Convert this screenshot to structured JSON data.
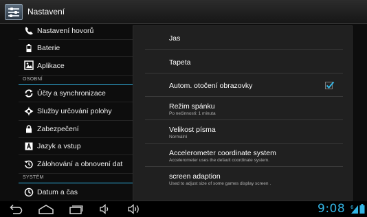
{
  "app": {
    "title": "Nastavení",
    "icon": "settings-sliders-icon"
  },
  "sidebar": {
    "items_top": [
      {
        "label": "Nastavení hovorů",
        "icon": "phone-icon"
      },
      {
        "label": "Baterie",
        "icon": "battery-icon"
      },
      {
        "label": "Aplikace",
        "icon": "apps-icon"
      }
    ],
    "section_personal": "OSOBNÍ",
    "items_personal": [
      {
        "label": "Účty a synchronizace",
        "icon": "sync-icon"
      },
      {
        "label": "Služby určování polohy",
        "icon": "location-icon"
      },
      {
        "label": "Zabezpečení",
        "icon": "lock-icon"
      },
      {
        "label": "Jazyk a vstup",
        "icon": "language-icon"
      },
      {
        "label": "Zálohování a obnovení dat",
        "icon": "backup-restore-icon"
      }
    ],
    "section_system": "SYSTÉM",
    "items_system": [
      {
        "label": "Datum a čas",
        "icon": "clock-icon"
      }
    ]
  },
  "display_settings": [
    {
      "title": "Jas",
      "summary": ""
    },
    {
      "title": "Tapeta",
      "summary": ""
    },
    {
      "title": "Autom. otočení obrazovky",
      "summary": "",
      "checked": true
    },
    {
      "title": "Režim spánku",
      "summary": "Po nečinnosti: 1 minuta"
    },
    {
      "title": "Velikost písma",
      "summary": "Normální"
    },
    {
      "title": "Accelerometer coordinate system",
      "summary": "Accelerometer uses the default coordinate system."
    },
    {
      "title": "screen adaption",
      "summary": "Used to adjust size of some games display screen ."
    }
  ],
  "navbar": {
    "buttons": [
      "back-icon",
      "home-icon",
      "recent-apps-icon",
      "volume-down-icon",
      "volume-up-icon"
    ],
    "clock": "9:08",
    "status_icons": [
      "signal-icon",
      "battery-status-icon"
    ]
  },
  "colors": {
    "accent": "#33b5e5",
    "panel": "#202020",
    "background": "#0d0d0d"
  }
}
